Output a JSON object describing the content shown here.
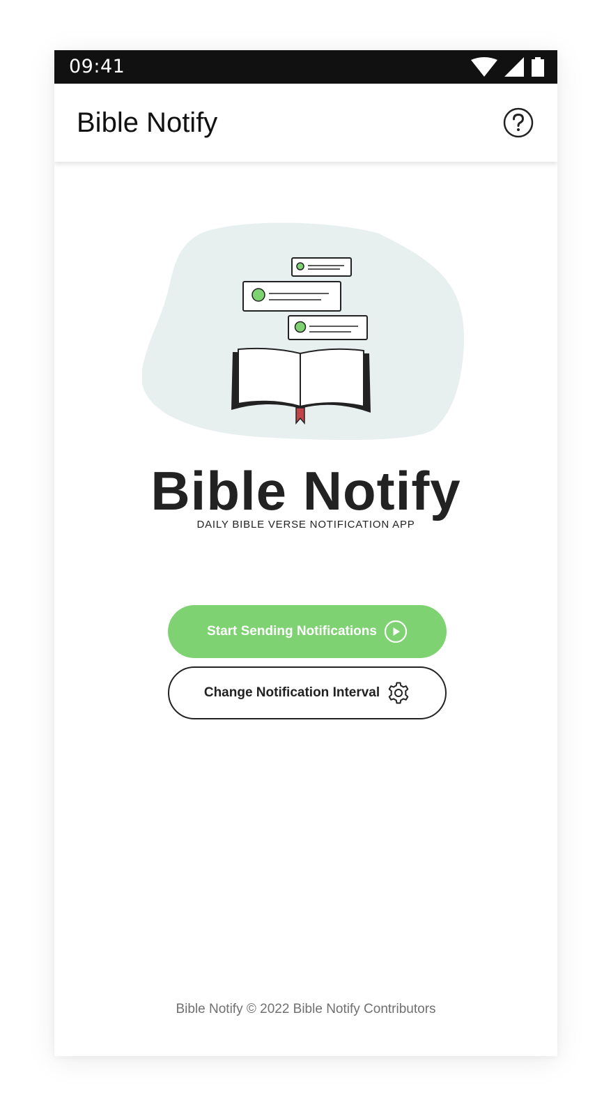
{
  "status_bar": {
    "time": "09:41",
    "icons": [
      "wifi-icon",
      "cellular-signal-icon",
      "battery-icon"
    ]
  },
  "app_bar": {
    "title": "Bible Notify",
    "help_icon": "help-circle-icon"
  },
  "hero": {
    "title": "Bible Notify",
    "subtitle": "DAILY BIBLE VERSE NOTIFICATION APP"
  },
  "actions": {
    "start_label": "Start Sending Notifications",
    "start_icon": "play-circle-icon",
    "interval_label": "Change Notification Interval",
    "interval_icon": "gear-icon"
  },
  "footer": {
    "text": "Bible Notify © 2022 Bible Notify Contributors"
  },
  "colors": {
    "accent_green": "#7ed271",
    "status_bar": "#111111",
    "blob": "#e8f0ef",
    "bookmark": "#c0454a",
    "text_dark": "#222222",
    "footer_text": "#707070"
  }
}
